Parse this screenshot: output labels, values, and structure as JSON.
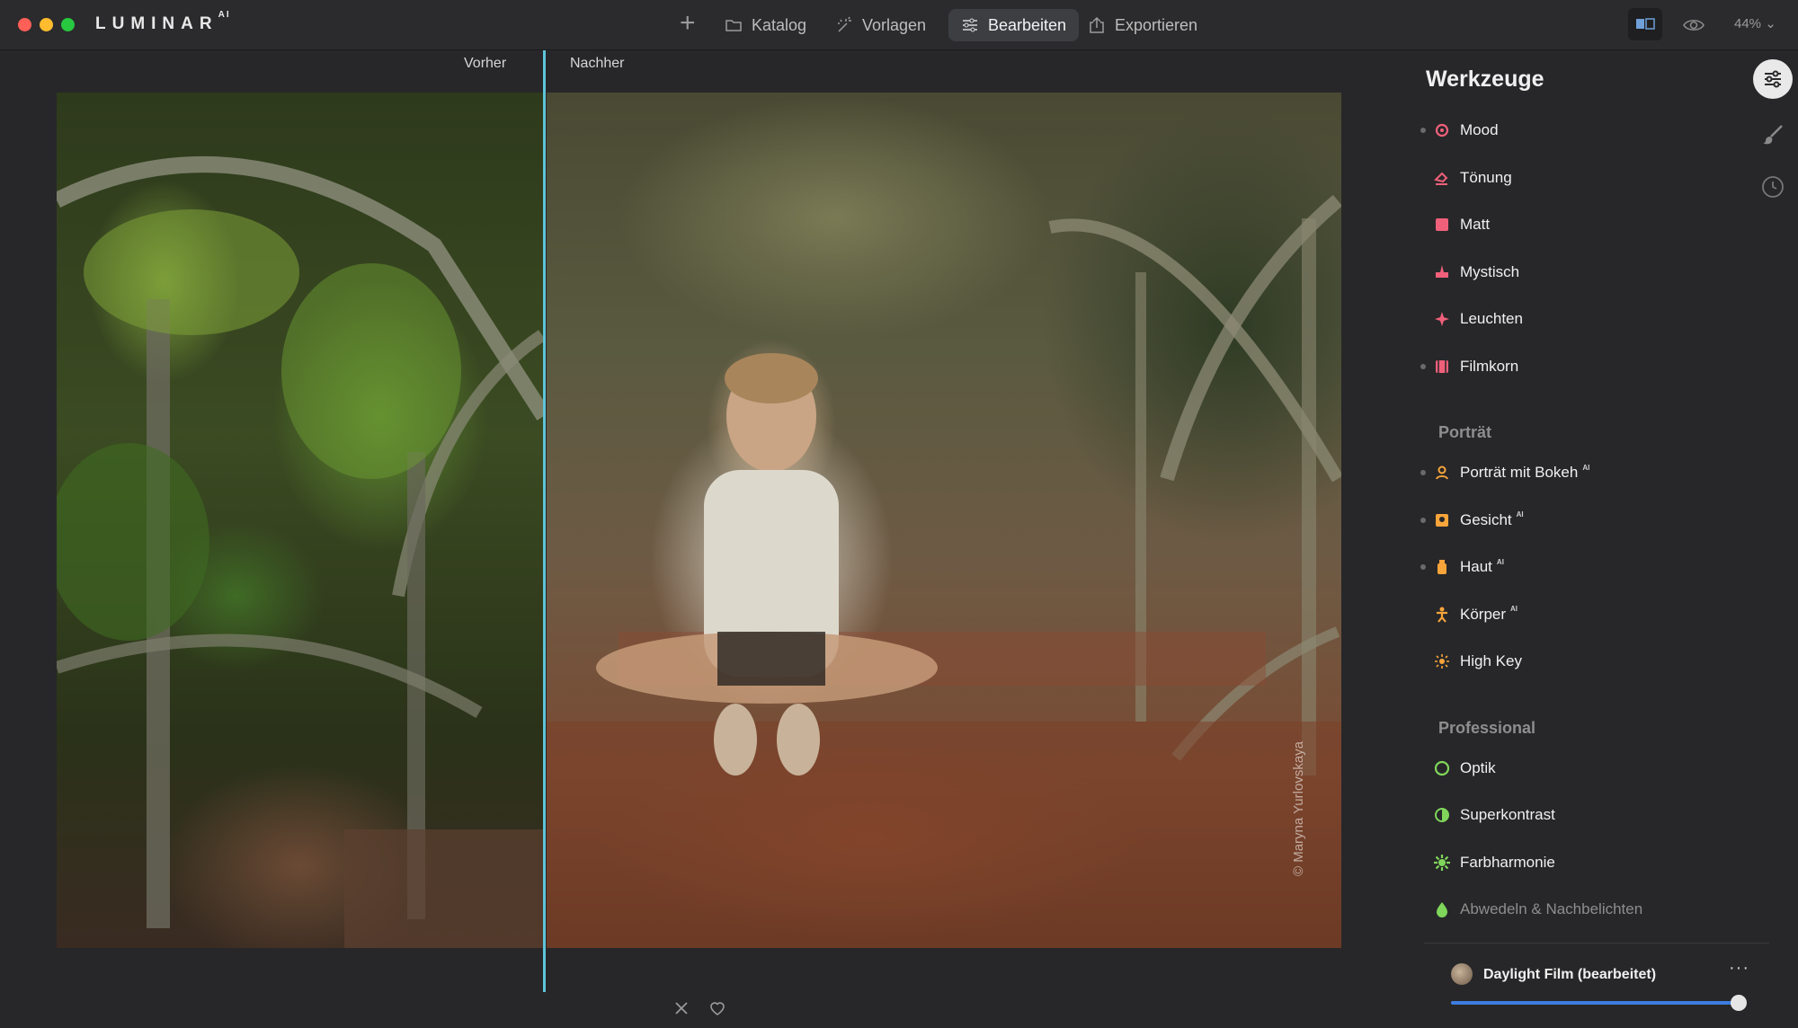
{
  "app": {
    "brand": "LUMINAR",
    "brand_suffix": "AI",
    "traffic_colors": [
      "#fe5f57",
      "#febc2e",
      "#28c840"
    ]
  },
  "toolbar": {
    "nav": [
      {
        "label": "Katalog",
        "icon": "folder-icon",
        "active": false
      },
      {
        "label": "Vorlagen",
        "icon": "sparkle-wand-icon",
        "active": false
      },
      {
        "label": "Bearbeiten",
        "icon": "sliders-icon",
        "active": true
      },
      {
        "label": "Exportieren",
        "icon": "share-icon",
        "active": false
      }
    ],
    "zoom": "44%"
  },
  "compare": {
    "before_label": "Vorher",
    "after_label": "Nachher",
    "accent": "#5fc4d8"
  },
  "photo": {
    "watermark": "© Maryna Yurlovskaya"
  },
  "panel": {
    "title": "Werkzeuge",
    "tools": [
      {
        "label": "Mood",
        "ai": "",
        "icon": "mood-icon",
        "color": "#f0607a",
        "dot": true
      },
      {
        "label": "Tönung",
        "ai": "",
        "icon": "toning-brush-icon",
        "color": "#f0607a",
        "dot": false
      },
      {
        "label": "Matt",
        "ai": "",
        "icon": "matte-square-icon",
        "color": "#f0607a",
        "dot": false
      },
      {
        "label": "Mystisch",
        "ai": "",
        "icon": "mystic-icon",
        "color": "#f0607a",
        "dot": false
      },
      {
        "label": "Leuchten",
        "ai": "",
        "icon": "glow-sparkle-icon",
        "color": "#f0607a",
        "dot": false
      },
      {
        "label": "Filmkorn",
        "ai": "",
        "icon": "film-grain-icon",
        "color": "#f0607a",
        "dot": true
      }
    ],
    "sections": [
      {
        "title": "Porträt",
        "tools": [
          {
            "label": "Porträt mit Bokeh",
            "ai": "AI",
            "icon": "portrait-bokeh-icon",
            "color": "#f7a43a",
            "dot": true
          },
          {
            "label": "Gesicht",
            "ai": "AI",
            "icon": "face-icon",
            "color": "#f7a43a",
            "dot": true
          },
          {
            "label": "Haut",
            "ai": "AI",
            "icon": "skin-icon",
            "color": "#f7a43a",
            "dot": true
          },
          {
            "label": "Körper",
            "ai": "AI",
            "icon": "body-icon",
            "color": "#f7a43a",
            "dot": false
          },
          {
            "label": "High Key",
            "ai": "",
            "icon": "high-key-icon",
            "color": "#f7a43a",
            "dot": false
          }
        ]
      },
      {
        "title": "Professional",
        "tools": [
          {
            "label": "Optik",
            "ai": "",
            "icon": "optics-icon",
            "color": "#7fd65a",
            "dot": false
          },
          {
            "label": "Superkontrast",
            "ai": "",
            "icon": "contrast-icon",
            "color": "#7fd65a",
            "dot": false
          },
          {
            "label": "Farbharmonie",
            "ai": "",
            "icon": "color-harmony-icon",
            "color": "#7fd65a",
            "dot": false
          },
          {
            "label": "Abwedeln & Nachbelichten",
            "ai": "",
            "icon": "dodge-burn-icon",
            "color": "#7fd65a",
            "dot": false
          }
        ]
      }
    ]
  },
  "preset": {
    "name": "Daylight Film (bearbeitet)",
    "more": "···",
    "amount": 1.0,
    "slider_color": "#3c7de0"
  }
}
